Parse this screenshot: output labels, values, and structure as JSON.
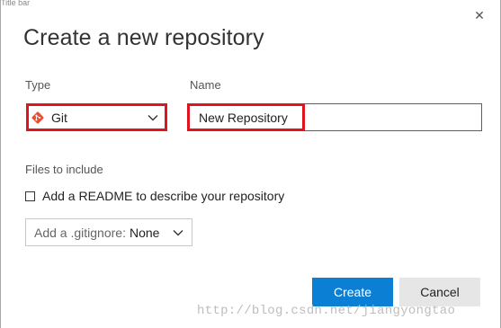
{
  "dialog": {
    "top_cropped_text": "Title bar",
    "close_glyph": "✕",
    "title": "Create a new repository"
  },
  "type": {
    "label": "Type",
    "value": "Git",
    "icon": "git-icon"
  },
  "name": {
    "label": "Name",
    "value": "New Repository"
  },
  "files": {
    "section_label": "Files to include",
    "readme_label": "Add a README to describe your repository",
    "readme_checked": false,
    "gitignore_prefix": "Add a .gitignore:",
    "gitignore_value": "None"
  },
  "buttons": {
    "create": "Create",
    "cancel": "Cancel"
  },
  "watermark": "http://blog.csdn.net/jiangyongtao",
  "colors": {
    "accent": "#0a7fd3",
    "highlight": "#e0141e",
    "git": "#e94e31"
  }
}
